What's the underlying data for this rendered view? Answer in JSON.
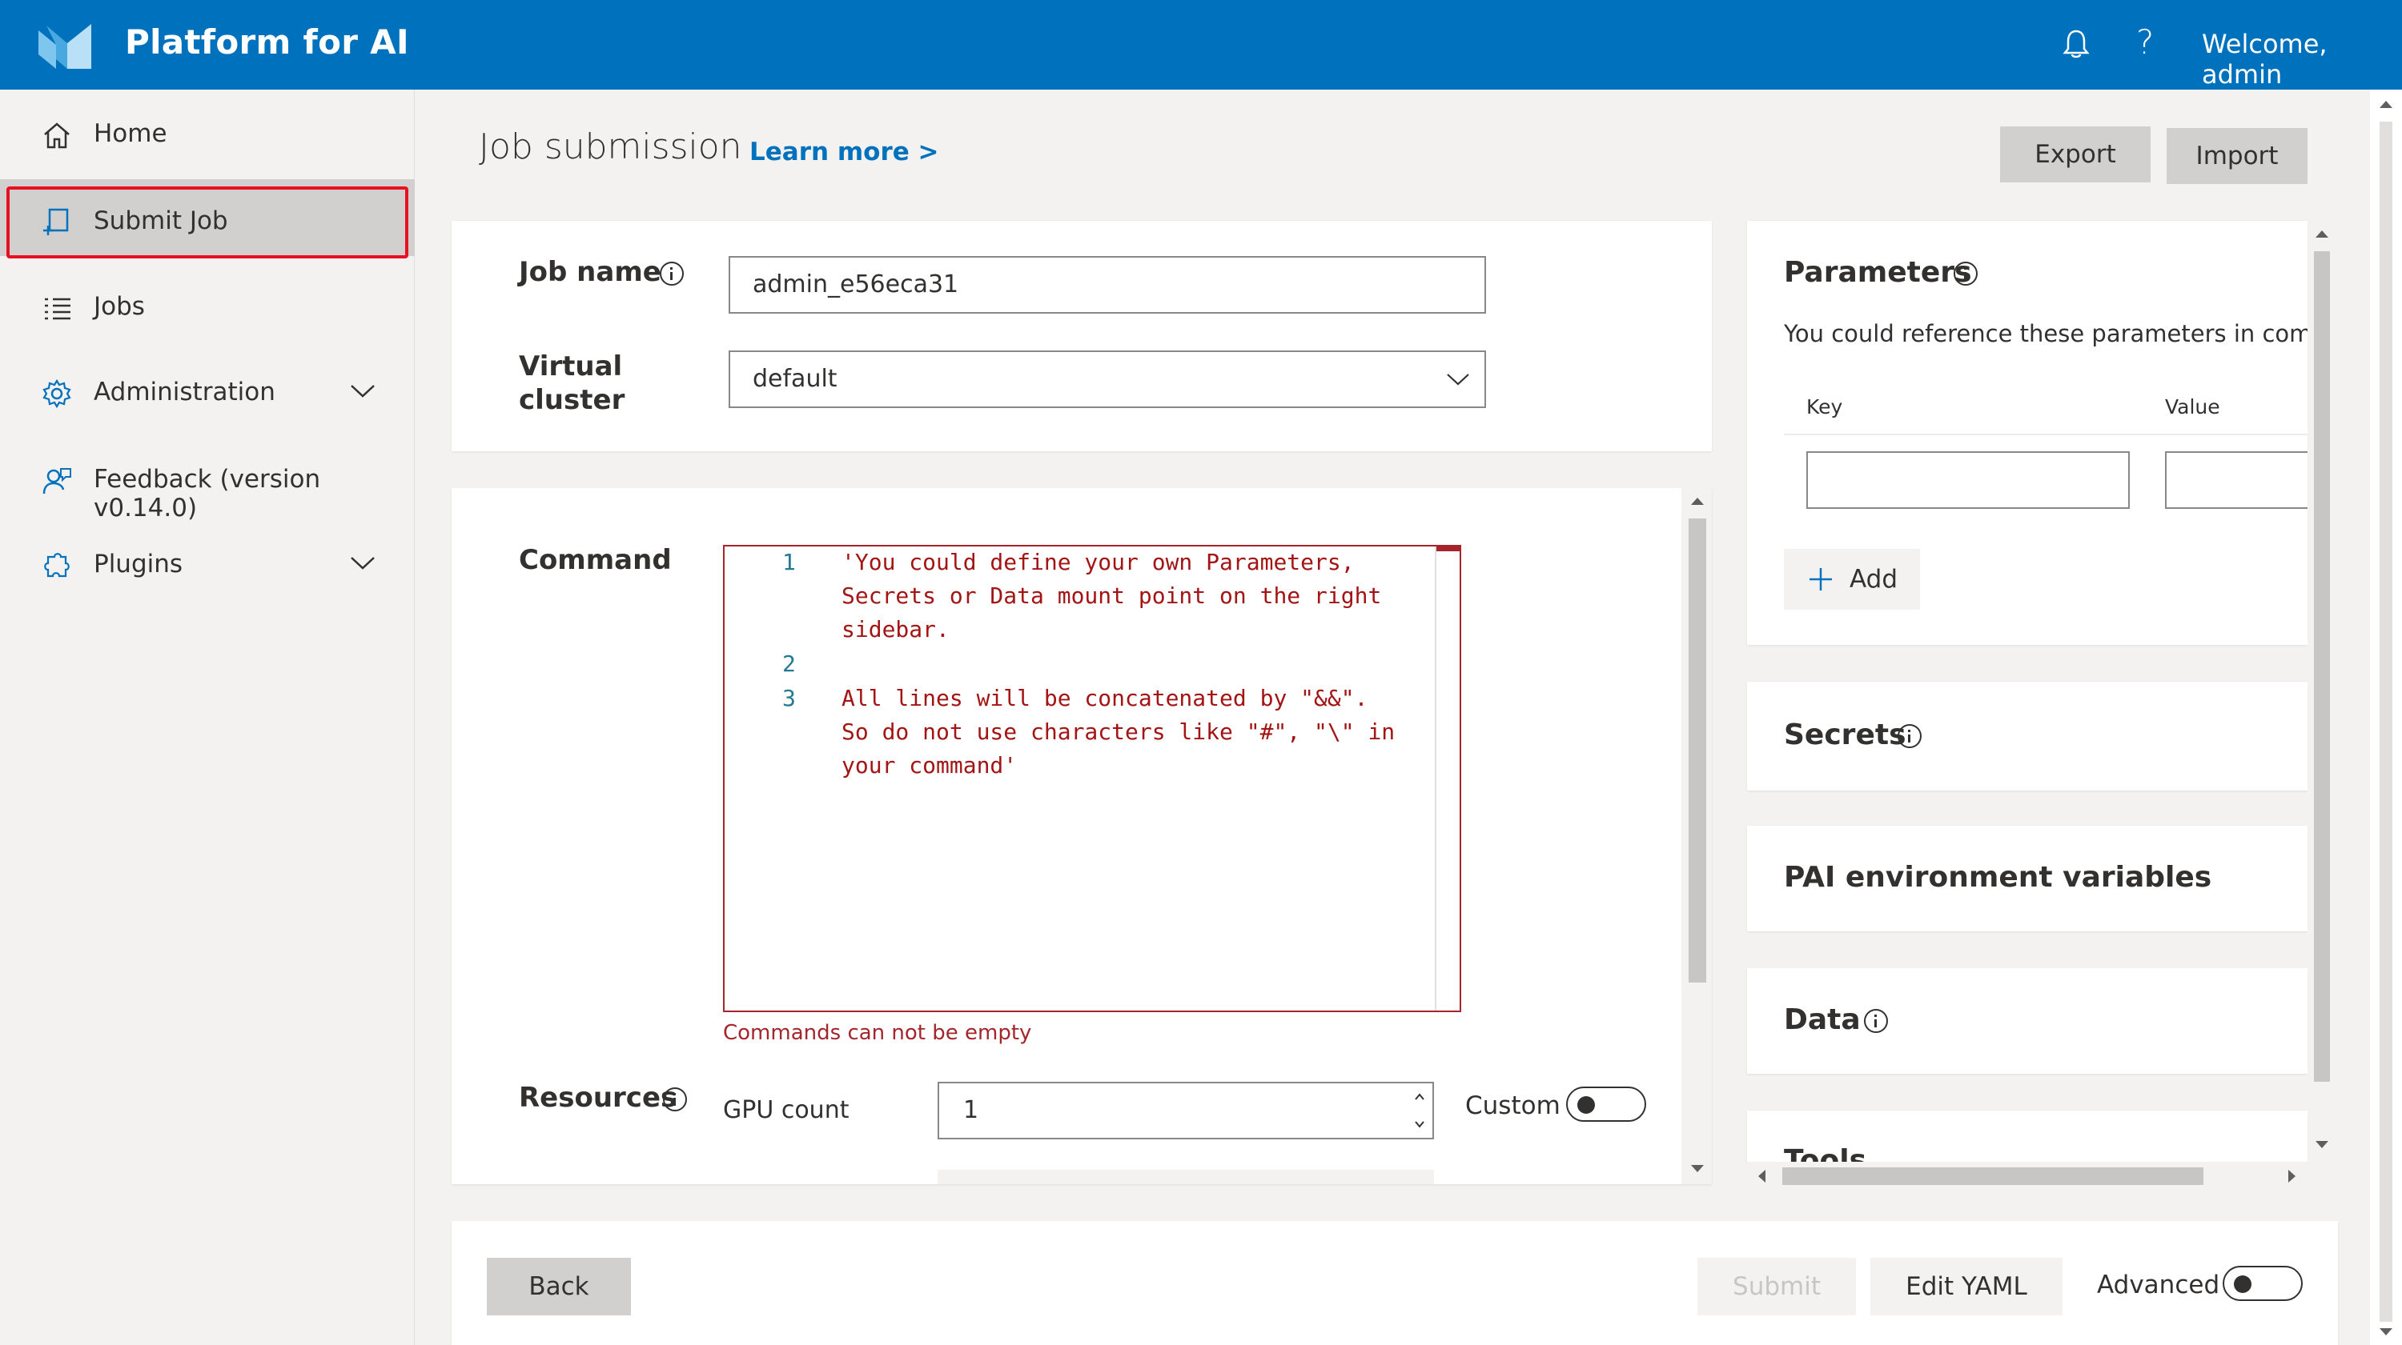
{
  "header": {
    "app_title": "Platform for AI",
    "help_glyph": "?",
    "welcome": "Welcome, admin",
    "brand_color": "#0071bc",
    "icons": [
      "logo-icon",
      "bell-icon",
      "help-icon"
    ]
  },
  "sidebar": {
    "items": [
      {
        "label": "Home",
        "icon": "home-icon"
      },
      {
        "label": "Submit Job",
        "icon": "submit-job-icon",
        "active": true
      },
      {
        "label": "Jobs",
        "icon": "list-icon"
      },
      {
        "label": "Administration",
        "icon": "gear-icon",
        "expandable": true
      },
      {
        "label": "Feedback (version v0.14.0)",
        "icon": "feedback-icon"
      },
      {
        "label": "Plugins",
        "icon": "plugin-icon",
        "expandable": true
      }
    ]
  },
  "main": {
    "title": "Job submission",
    "learn_more": "Learn more >",
    "export_label": "Export",
    "import_label": "Import",
    "job_name_label": "Job name",
    "job_name_value": "admin_e56eca31",
    "virtual_cluster_label_1": "Virtual",
    "virtual_cluster_label_2": "cluster",
    "virtual_cluster_value": "default",
    "command_label": "Command",
    "command_lines": [
      {
        "num": "1",
        "text": "'You could define your own Parameters,"
      },
      {
        "num": "",
        "text": "Secrets or Data mount point on the right"
      },
      {
        "num": "",
        "text": "sidebar."
      },
      {
        "num": "2",
        "text": ""
      },
      {
        "num": "3",
        "text": "All lines will be concatenated by \"&&\"."
      },
      {
        "num": "",
        "text": "So do not use characters like \"#\", \"\\\" in"
      },
      {
        "num": "",
        "text": "your command'"
      }
    ],
    "command_error": "Commands can not be empty",
    "resources_label": "Resources",
    "gpu_count_label": "GPU count",
    "gpu_count_value": "1",
    "custom_label": "Custom",
    "error_color": "#a4262c"
  },
  "right_panel": {
    "parameters_title": "Parameters",
    "parameters_desc": "You could reference these parameters in comm",
    "key_label": "Key",
    "value_label": "Value",
    "add_label": "Add",
    "secrets_title": "Secrets",
    "pai_env_title": "PAI environment variables",
    "data_title": "Data",
    "tools_title": "Tools"
  },
  "footer": {
    "back_label": "Back",
    "submit_label": "Submit",
    "edit_yaml_label": "Edit YAML",
    "advanced_label": "Advanced"
  }
}
